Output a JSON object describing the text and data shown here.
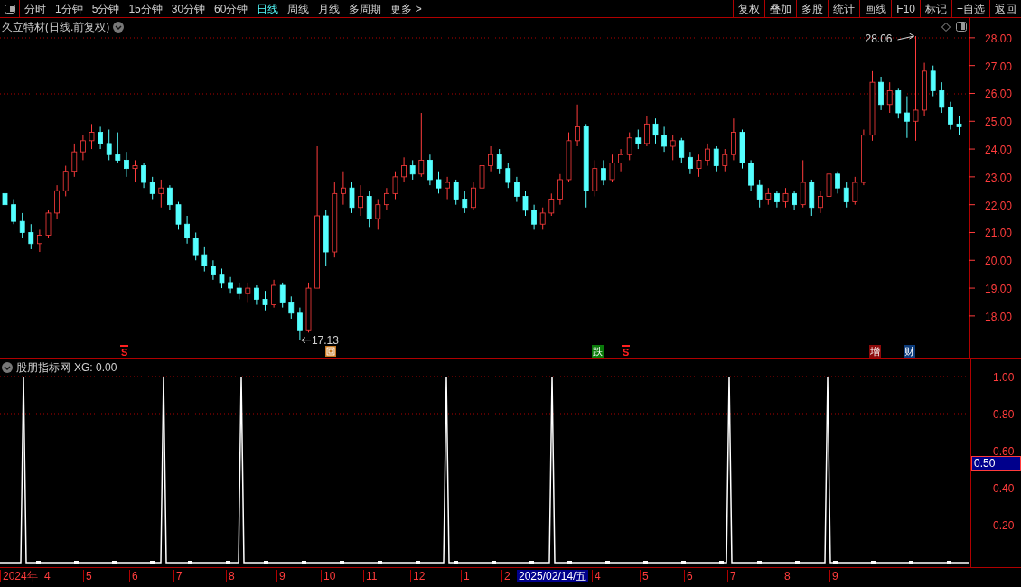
{
  "toolbar": {
    "periods": [
      {
        "label": "分时",
        "selected": false
      },
      {
        "label": "1分钟",
        "selected": false
      },
      {
        "label": "5分钟",
        "selected": false
      },
      {
        "label": "15分钟",
        "selected": false
      },
      {
        "label": "30分钟",
        "selected": false
      },
      {
        "label": "60分钟",
        "selected": false
      },
      {
        "label": "日线",
        "selected": true
      },
      {
        "label": "周线",
        "selected": false
      },
      {
        "label": "月线",
        "selected": false
      },
      {
        "label": "多周期",
        "selected": false
      }
    ],
    "more": "更多 >",
    "buttons": [
      "复权",
      "叠加",
      "多股",
      "统计",
      "画线",
      "F10",
      "标记",
      "+自选",
      "返回"
    ]
  },
  "price_chart": {
    "title": "久立特材(日线.前复权)",
    "high_label": "28.06",
    "low_label": "17.13",
    "chart_data": {
      "type": "candlestick",
      "ylim": [
        16.47,
        28.71
      ],
      "yticks": [
        {
          "value": 28,
          "label": "28.00"
        },
        {
          "value": 27,
          "label": "27.00"
        },
        {
          "value": 26,
          "label": "26.00"
        },
        {
          "value": 25,
          "label": "25.00"
        },
        {
          "value": 24,
          "label": "24.00"
        },
        {
          "value": 23,
          "label": "23.00"
        },
        {
          "value": 22,
          "label": "22.00"
        },
        {
          "value": 21,
          "label": "21.00"
        },
        {
          "value": 20,
          "label": "20.00"
        },
        {
          "value": 19,
          "label": "19.00"
        },
        {
          "value": 18,
          "label": "18.00"
        }
      ],
      "ohlc": [
        [
          22.4,
          22.6,
          21.9,
          22.0
        ],
        [
          22.0,
          22.2,
          21.3,
          21.4
        ],
        [
          21.4,
          21.7,
          20.8,
          21.0
        ],
        [
          21.0,
          21.3,
          20.4,
          20.6
        ],
        [
          20.6,
          21.1,
          20.3,
          20.9
        ],
        [
          20.9,
          21.8,
          20.8,
          21.7
        ],
        [
          21.7,
          22.7,
          21.5,
          22.5
        ],
        [
          22.5,
          23.4,
          22.3,
          23.2
        ],
        [
          23.2,
          24.2,
          23.0,
          23.9
        ],
        [
          23.9,
          24.5,
          23.6,
          24.3
        ],
        [
          24.3,
          24.9,
          24.0,
          24.6
        ],
        [
          24.6,
          24.8,
          24.0,
          24.2
        ],
        [
          24.2,
          24.7,
          23.6,
          23.8
        ],
        [
          23.8,
          24.6,
          23.5,
          23.6
        ],
        [
          23.6,
          23.9,
          23.0,
          23.3
        ],
        [
          23.3,
          23.6,
          22.8,
          23.4
        ],
        [
          23.4,
          23.5,
          22.6,
          22.8
        ],
        [
          22.8,
          23.0,
          22.2,
          22.4
        ],
        [
          22.4,
          22.9,
          21.9,
          22.6
        ],
        [
          22.6,
          22.7,
          21.8,
          22.0
        ],
        [
          22.0,
          22.1,
          21.1,
          21.3
        ],
        [
          21.3,
          21.6,
          20.6,
          20.8
        ],
        [
          20.8,
          21.0,
          20.0,
          20.2
        ],
        [
          20.2,
          20.5,
          19.6,
          19.8
        ],
        [
          19.8,
          20.0,
          19.3,
          19.5
        ],
        [
          19.5,
          19.7,
          19.0,
          19.2
        ],
        [
          19.2,
          19.4,
          18.8,
          19.0
        ],
        [
          19.0,
          19.2,
          18.6,
          18.8
        ],
        [
          18.8,
          19.2,
          18.5,
          19.0
        ],
        [
          19.0,
          19.1,
          18.4,
          18.6
        ],
        [
          18.6,
          18.9,
          18.2,
          18.4
        ],
        [
          18.4,
          19.3,
          18.3,
          19.1
        ],
        [
          19.1,
          19.2,
          18.3,
          18.5
        ],
        [
          18.5,
          18.7,
          17.9,
          18.1
        ],
        [
          18.1,
          18.3,
          17.13,
          17.5
        ],
        [
          17.5,
          19.2,
          17.4,
          19.0
        ],
        [
          19.0,
          24.1,
          19.0,
          21.6
        ],
        [
          21.6,
          21.8,
          19.8,
          20.3
        ],
        [
          20.3,
          22.8,
          20.1,
          22.4
        ],
        [
          22.4,
          23.2,
          22.0,
          22.6
        ],
        [
          22.6,
          22.8,
          21.7,
          21.9
        ],
        [
          21.9,
          22.7,
          21.6,
          22.3
        ],
        [
          22.3,
          22.5,
          21.2,
          21.5
        ],
        [
          21.5,
          22.2,
          21.1,
          22.0
        ],
        [
          22.0,
          22.6,
          21.8,
          22.4
        ],
        [
          22.4,
          23.2,
          22.2,
          23.0
        ],
        [
          23.0,
          23.7,
          22.8,
          23.4
        ],
        [
          23.4,
          23.6,
          22.9,
          23.1
        ],
        [
          23.1,
          25.3,
          23.0,
          23.6
        ],
        [
          23.6,
          23.8,
          22.7,
          22.9
        ],
        [
          22.9,
          23.2,
          22.4,
          22.6
        ],
        [
          22.6,
          23.0,
          22.2,
          22.8
        ],
        [
          22.8,
          22.9,
          22.0,
          22.2
        ],
        [
          22.2,
          22.5,
          21.7,
          21.9
        ],
        [
          21.9,
          22.8,
          21.8,
          22.6
        ],
        [
          22.6,
          23.6,
          22.5,
          23.4
        ],
        [
          23.4,
          24.1,
          23.2,
          23.8
        ],
        [
          23.8,
          24.0,
          23.1,
          23.3
        ],
        [
          23.3,
          23.5,
          22.6,
          22.8
        ],
        [
          22.8,
          23.0,
          22.1,
          22.3
        ],
        [
          22.3,
          22.5,
          21.6,
          21.8
        ],
        [
          21.8,
          22.0,
          21.1,
          21.3
        ],
        [
          21.3,
          21.9,
          21.1,
          21.7
        ],
        [
          21.7,
          22.4,
          21.6,
          22.2
        ],
        [
          22.2,
          23.1,
          22.0,
          22.9
        ],
        [
          22.9,
          24.6,
          22.8,
          24.3
        ],
        [
          24.3,
          25.6,
          24.1,
          24.8
        ],
        [
          24.8,
          24.9,
          21.9,
          22.5
        ],
        [
          22.5,
          23.6,
          22.3,
          23.3
        ],
        [
          23.3,
          23.6,
          22.7,
          22.9
        ],
        [
          22.9,
          23.8,
          22.8,
          23.5
        ],
        [
          23.5,
          24.0,
          23.2,
          23.8
        ],
        [
          23.8,
          24.6,
          23.6,
          24.4
        ],
        [
          24.4,
          24.7,
          24.0,
          24.2
        ],
        [
          24.2,
          25.2,
          24.1,
          24.9
        ],
        [
          24.9,
          25.1,
          24.2,
          24.5
        ],
        [
          24.5,
          24.8,
          23.9,
          24.1
        ],
        [
          24.1,
          24.5,
          23.6,
          24.3
        ],
        [
          24.3,
          24.4,
          23.5,
          23.7
        ],
        [
          23.7,
          23.9,
          23.1,
          23.3
        ],
        [
          23.3,
          23.8,
          23.0,
          23.6
        ],
        [
          23.6,
          24.2,
          23.4,
          24.0
        ],
        [
          24.0,
          24.1,
          23.2,
          23.4
        ],
        [
          23.4,
          24.0,
          23.2,
          23.8
        ],
        [
          23.8,
          25.1,
          23.6,
          24.6
        ],
        [
          24.6,
          24.7,
          23.3,
          23.5
        ],
        [
          23.5,
          23.6,
          22.5,
          22.7
        ],
        [
          22.7,
          22.9,
          21.9,
          22.2
        ],
        [
          22.2,
          22.6,
          22.0,
          22.4
        ],
        [
          22.4,
          22.5,
          21.9,
          22.1
        ],
        [
          22.1,
          22.6,
          21.9,
          22.4
        ],
        [
          22.4,
          22.5,
          21.8,
          22.0
        ],
        [
          22.0,
          23.6,
          21.9,
          22.8
        ],
        [
          22.8,
          22.9,
          21.6,
          21.9
        ],
        [
          21.9,
          22.5,
          21.7,
          22.3
        ],
        [
          22.3,
          23.3,
          22.2,
          23.1
        ],
        [
          23.1,
          23.2,
          22.4,
          22.6
        ],
        [
          22.6,
          22.8,
          21.9,
          22.1
        ],
        [
          22.1,
          23.0,
          22.0,
          22.8
        ],
        [
          22.8,
          24.7,
          22.7,
          24.5
        ],
        [
          24.5,
          26.8,
          24.3,
          26.4
        ],
        [
          26.4,
          26.6,
          25.4,
          25.6
        ],
        [
          25.6,
          26.4,
          25.3,
          26.1
        ],
        [
          26.1,
          26.2,
          25.1,
          25.3
        ],
        [
          25.3,
          25.9,
          24.4,
          25.0
        ],
        [
          25.0,
          28.06,
          24.3,
          25.4
        ],
        [
          25.4,
          27.1,
          25.2,
          26.8
        ],
        [
          26.8,
          27.0,
          25.9,
          26.1
        ],
        [
          26.1,
          26.4,
          25.3,
          25.5
        ],
        [
          25.5,
          25.7,
          24.7,
          24.9
        ],
        [
          24.9,
          25.2,
          24.5,
          24.8
        ]
      ]
    },
    "markers": [
      {
        "kind": "signal",
        "text": "S"
      },
      {
        "kind": "box"
      },
      {
        "kind": "tag",
        "text": "跌",
        "color": "#0a7a0a"
      },
      {
        "kind": "signal",
        "text": "S"
      },
      {
        "kind": "tag",
        "text": "增",
        "color": "#8c0a0a"
      },
      {
        "kind": "tag",
        "text": "财",
        "color": "#0c3c7c"
      }
    ]
  },
  "indicator": {
    "name": "股朋指标网",
    "reading": "XG: 0.00",
    "y_labels": [
      "1.00",
      "0.80",
      "0.60",
      "0.40",
      "0.20"
    ],
    "cursor_value": "0.50"
  },
  "date_axis": {
    "labels": [
      {
        "label": "2024年",
        "selected": false
      },
      {
        "label": "4",
        "selected": false
      },
      {
        "label": "5",
        "selected": false
      },
      {
        "label": "6",
        "selected": false
      },
      {
        "label": "7",
        "selected": false
      },
      {
        "label": "8",
        "selected": false
      },
      {
        "label": "9",
        "selected": false
      },
      {
        "label": "10",
        "selected": false
      },
      {
        "label": "11",
        "selected": false
      },
      {
        "label": "12",
        "selected": false
      },
      {
        "label": "1",
        "selected": false
      },
      {
        "label": "2",
        "selected": false
      },
      {
        "label": "2025/02/14/五",
        "selected": true
      },
      {
        "label": "4",
        "selected": false
      },
      {
        "label": "5",
        "selected": false
      },
      {
        "label": "6",
        "selected": false
      },
      {
        "label": "7",
        "selected": false
      },
      {
        "label": "8",
        "selected": false
      },
      {
        "label": "9",
        "selected": false
      }
    ]
  }
}
